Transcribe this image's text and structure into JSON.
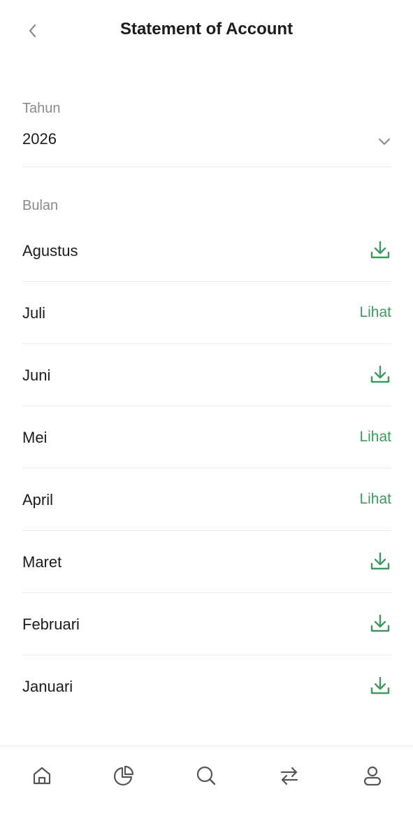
{
  "header": {
    "title": "Statement of Account",
    "back_icon": "chevron-left-icon"
  },
  "year": {
    "label": "Tahun",
    "value": "2026",
    "dropdown_icon": "chevron-down-icon"
  },
  "months_label": "Bulan",
  "months": [
    {
      "name": "Agustus",
      "action": "download",
      "action_label": ""
    },
    {
      "name": "Juli",
      "action": "view",
      "action_label": "Lihat"
    },
    {
      "name": "Juni",
      "action": "download",
      "action_label": ""
    },
    {
      "name": "Mei",
      "action": "view",
      "action_label": "Lihat"
    },
    {
      "name": "April",
      "action": "view",
      "action_label": "Lihat"
    },
    {
      "name": "Maret",
      "action": "download",
      "action_label": ""
    },
    {
      "name": "Februari",
      "action": "download",
      "action_label": ""
    },
    {
      "name": "Januari",
      "action": "download",
      "action_label": ""
    }
  ],
  "nav": [
    {
      "name": "home-icon"
    },
    {
      "name": "pie-chart-icon"
    },
    {
      "name": "search-icon"
    },
    {
      "name": "transfer-icon"
    },
    {
      "name": "profile-icon"
    }
  ],
  "colors": {
    "accent": "#3d9a5f",
    "divider": "#ececec",
    "muted_text": "#8a8a8a",
    "icon_gray": "#8a8a8a",
    "nav_icon": "#555555"
  }
}
